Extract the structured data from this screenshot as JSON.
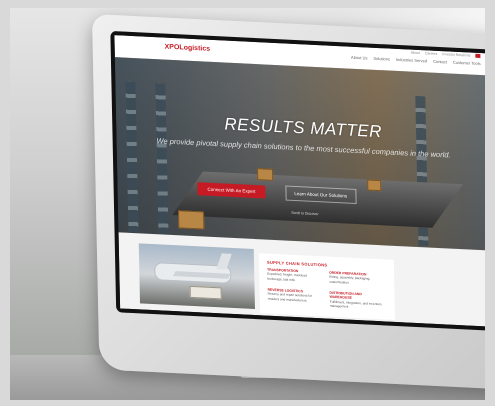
{
  "site": {
    "logo": "XPOLogistics",
    "utility_links": [
      "About",
      "Careers",
      "Investor Relations"
    ],
    "nav_links": [
      "About Us",
      "Solutions",
      "Industries Served",
      "Contact",
      "Customer Tools"
    ]
  },
  "hero": {
    "title": "RESULTS MATTER",
    "subtitle": "We provide pivotal supply chain solutions to the most successful companies in the world.",
    "primary_cta": "Connect With An Expert",
    "secondary_cta": "Learn About Our Solutions",
    "scroll_hint": "Scroll to Discover"
  },
  "solutions": {
    "title": "SUPPLY CHAIN SOLUTIONS",
    "left": [
      {
        "heading": "TRANSPORTATION",
        "text": "Expedited, freight, truckload brokerage, last mile"
      },
      {
        "heading": "REVERSE LOGISTICS",
        "text": "Returns and repair solutions for retailers and manufacturers"
      }
    ],
    "right": [
      {
        "heading": "ORDER PREPARATION",
        "text": "Kitting, assembly, packaging, customization"
      },
      {
        "heading": "DISTRIBUTION AND WAREHOUSE",
        "text": "Fulfillment, integration, and inventory management"
      }
    ]
  },
  "colors": {
    "brand_red": "#c61b24"
  }
}
